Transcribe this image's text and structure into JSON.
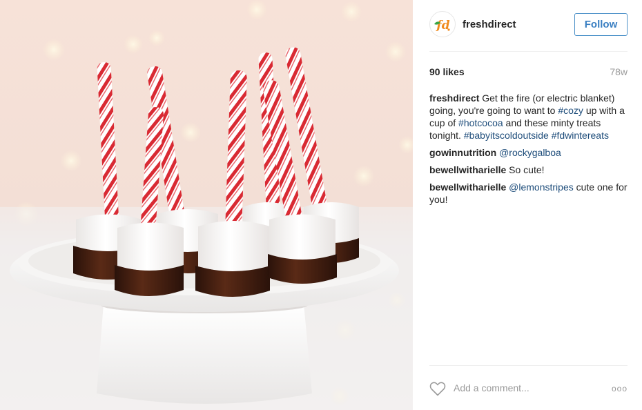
{
  "post": {
    "image_alt": "Chocolate dipped marshmallows with candy cane sticks on a white cake stand",
    "account": {
      "username": "freshdirect",
      "avatar_icon": "freshdirect-logo-icon",
      "follow_label": "Follow"
    },
    "likes_label": "90 likes",
    "age": "78w",
    "caption": {
      "user": "freshdirect",
      "text_1": " Get the fire (or electric blanket) going, you're going to want to ",
      "tag_1": "#cozy",
      "text_2": " up with a cup of ",
      "tag_2": "#hotcocoa",
      "text_3": " and these minty treats tonight. ",
      "tag_3": "#babyitscoldoutside",
      "text_4": " ",
      "tag_4": "#fdwintereats"
    },
    "comments": [
      {
        "user": "gowinnutrition",
        "mention": "@rockygalboa",
        "text": ""
      },
      {
        "user": "bewellwitharielle",
        "mention": "",
        "text": "So cute!"
      },
      {
        "user": "bewellwitharielle",
        "mention": "@lemonstripes",
        "text": " cute one for you!"
      }
    ],
    "footer": {
      "like_icon": "heart-icon",
      "add_comment_placeholder": "Add a comment...",
      "more_icon": "more-options-icon",
      "more_label": "ooo"
    }
  },
  "colors": {
    "link": "#1d4c7a",
    "follow_blue": "#3a7fc2",
    "muted": "#999999"
  }
}
